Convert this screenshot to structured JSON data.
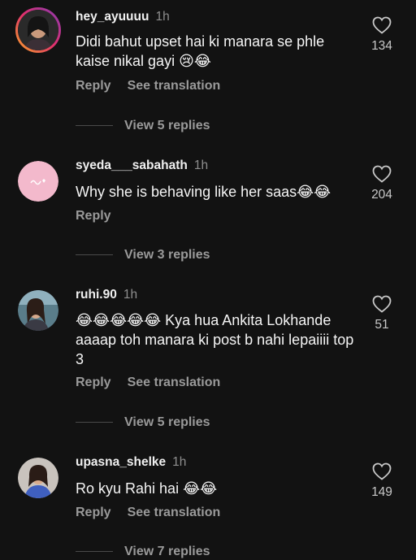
{
  "comments": [
    {
      "username": "hey_ayuuuu",
      "time": "1h",
      "text": "Didi bahut upset hai ki manara se phle kaise nikal gayi 😢😂",
      "likes": "134",
      "actions": [
        "Reply",
        "See translation"
      ],
      "replies": "View 5 replies",
      "avatar_icon": "avatar-woman-dark"
    },
    {
      "username": "syeda___sabahath",
      "time": "1h",
      "text": "Why she is behaving like her saas😂😂",
      "likes": "204",
      "actions": [
        "Reply"
      ],
      "replies": "View 3 replies",
      "avatar_icon": "avatar-pink-arabic-text"
    },
    {
      "username": "ruhi.90",
      "time": "1h",
      "text": "😂😂😂😂😂 Kya hua Ankita Lokhande aaaap toh manara ki post b nahi lepaiiii top 3",
      "likes": "51",
      "actions": [
        "Reply",
        "See translation"
      ],
      "replies": "View 5 replies",
      "avatar_icon": "avatar-woman-outdoor"
    },
    {
      "username": "upasna_shelke",
      "time": "1h",
      "text": "Ro kyu Rahi hai 😂😂",
      "likes": "149",
      "actions": [
        "Reply",
        "See translation"
      ],
      "replies": "View 7 replies",
      "avatar_icon": "avatar-woman-blue"
    }
  ],
  "colors": {
    "background": "#121212",
    "secondary_text": "#9a9a9a",
    "primary_text": "#f5f5f5"
  }
}
